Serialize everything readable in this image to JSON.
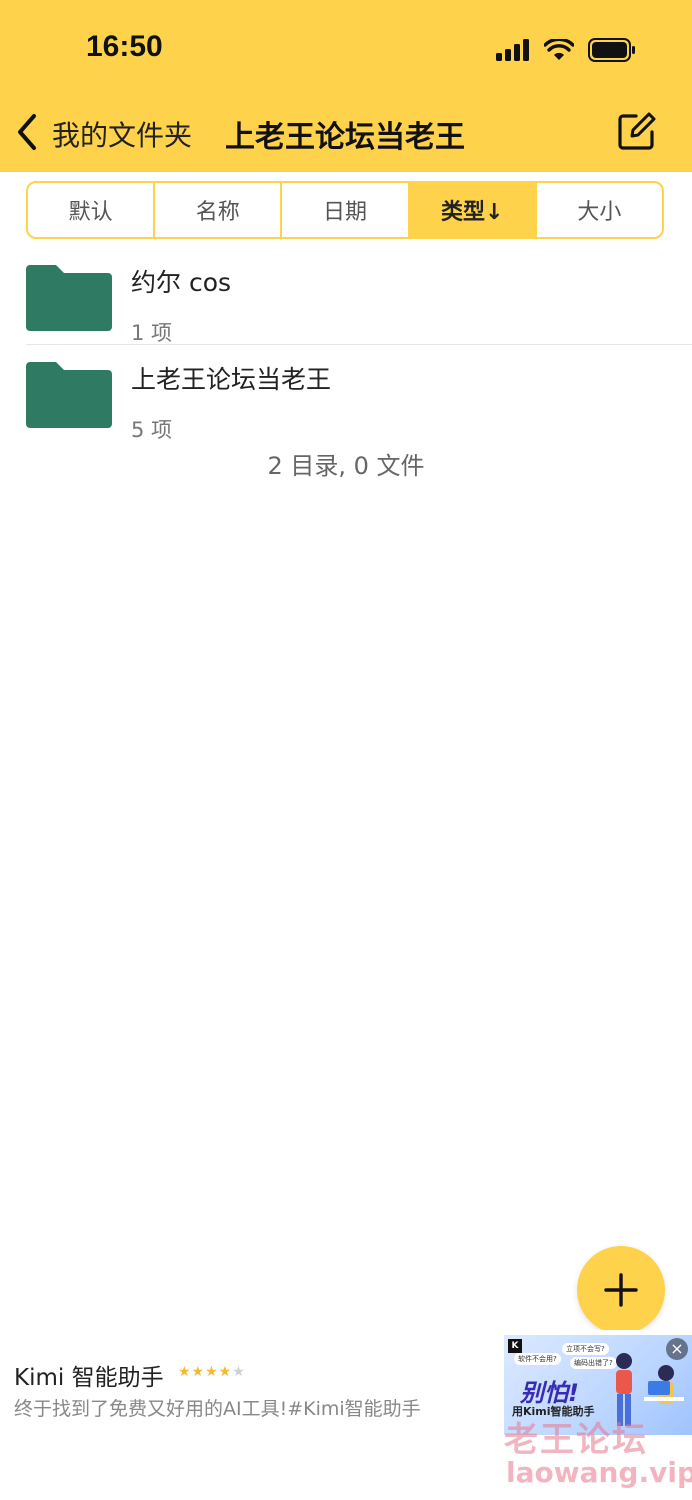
{
  "status_bar": {
    "time": "16:50"
  },
  "nav": {
    "back_label": "我的文件夹",
    "title": "上老王论坛当老王"
  },
  "sort_tabs": [
    {
      "label": "默认"
    },
    {
      "label": "名称"
    },
    {
      "label": "日期"
    },
    {
      "label": "类型↓",
      "active": true
    },
    {
      "label": "大小"
    }
  ],
  "folders": [
    {
      "name": "约尔 cos",
      "count": "1 项"
    },
    {
      "name": "上老王论坛当老王",
      "count": "5 项"
    }
  ],
  "summary": "2 目录, 0 文件",
  "ad": {
    "title": "Kimi 智能助手",
    "rating": 4,
    "rating_max": 5,
    "description": "终于找到了免费又好用的AI工具!#Kimi智能助手",
    "image_texts": {
      "logo": "K",
      "bubble1": "软件不会用?",
      "bubble2": "立项不会写?",
      "bubble3": "编码出错了?",
      "headline": "别怕!",
      "subline": "用Kimi智能助手"
    }
  },
  "watermark": {
    "cn": "老王论坛",
    "url": "laowang.vip"
  },
  "colors": {
    "accent": "#FFD24C",
    "folder": "#2F7A62"
  }
}
